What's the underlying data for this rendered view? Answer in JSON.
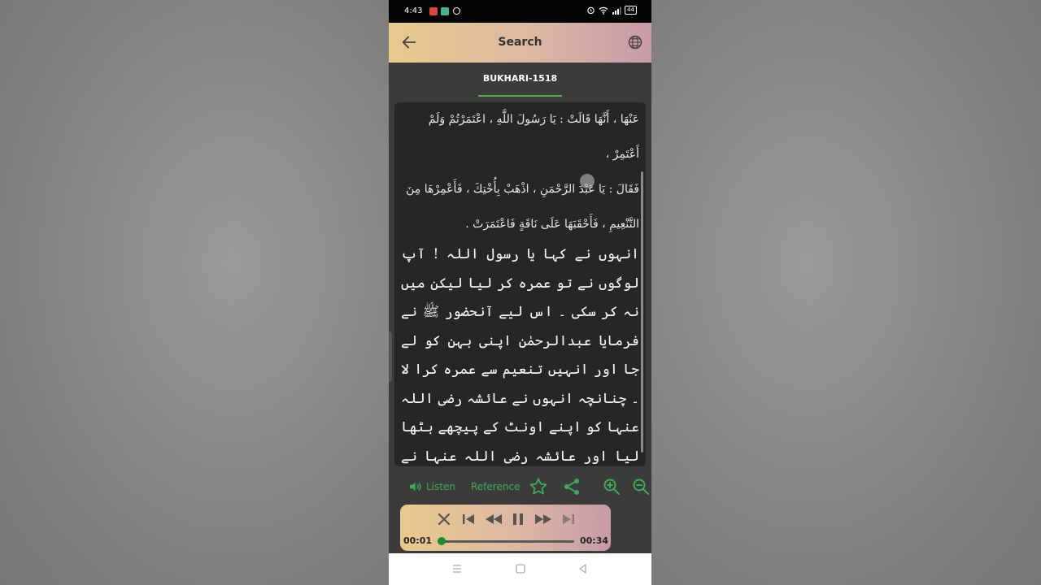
{
  "status_bar": {
    "time": "4:43",
    "battery": "44"
  },
  "appbar": {
    "title": "Search",
    "back_icon": "arrow-left-icon",
    "language_icon": "globe-icon"
  },
  "tabs": [
    {
      "label": "BUKHARI-1518",
      "active": true
    }
  ],
  "hadith": {
    "arabic_lines": [
      "عَنْهَا ، أَنَّهَا قَالَتْ : يَا رَسُولَ اللَّهِ ، اعْتَمَرْتُمْ وَلَمْ أَعْتَمِرْ ،",
      "فَقَالَ : يَا عَبْدَ الرَّحْمَنِ ، اذْهَبْ بِأُخْتِكَ ، فَأَعْمِرْهَا مِنَ",
      "التَّنْعِيمِ ، فَأَحْقَبَهَا عَلَى نَاقَةٍ فَاعْتَمَرَتْ ."
    ],
    "urdu_text": "انہوں نے کہا یا رسول اللہ ! آپ لوگوں نے تو عمرہ کر لیا لیکن میں نہ کر سکی ۔ اس لیے آنحضور ﷺ نے فرمایا عبدالرحمٰن اپنی بہن کو لے جا اور انہیں تنعیم سے عمرہ کرا لا ۔ چنانچہ انہوں نے عائشہ رضی اللہ عنہا کو اپنے اونٹ کے پیچھے بٹھا لیا اور عائشہ رضی اللہ عنہا نے عمرہ ادا کیا ۔"
  },
  "actions": {
    "listen_label": "Listen",
    "reference_label": "Reference"
  },
  "player": {
    "current_time": "00:01",
    "total_time": "00:34",
    "progress": 0.03
  },
  "colors": {
    "accent": "#3daa55",
    "gradient_start": "#e9c98c",
    "gradient_end": "#c89aa8"
  }
}
